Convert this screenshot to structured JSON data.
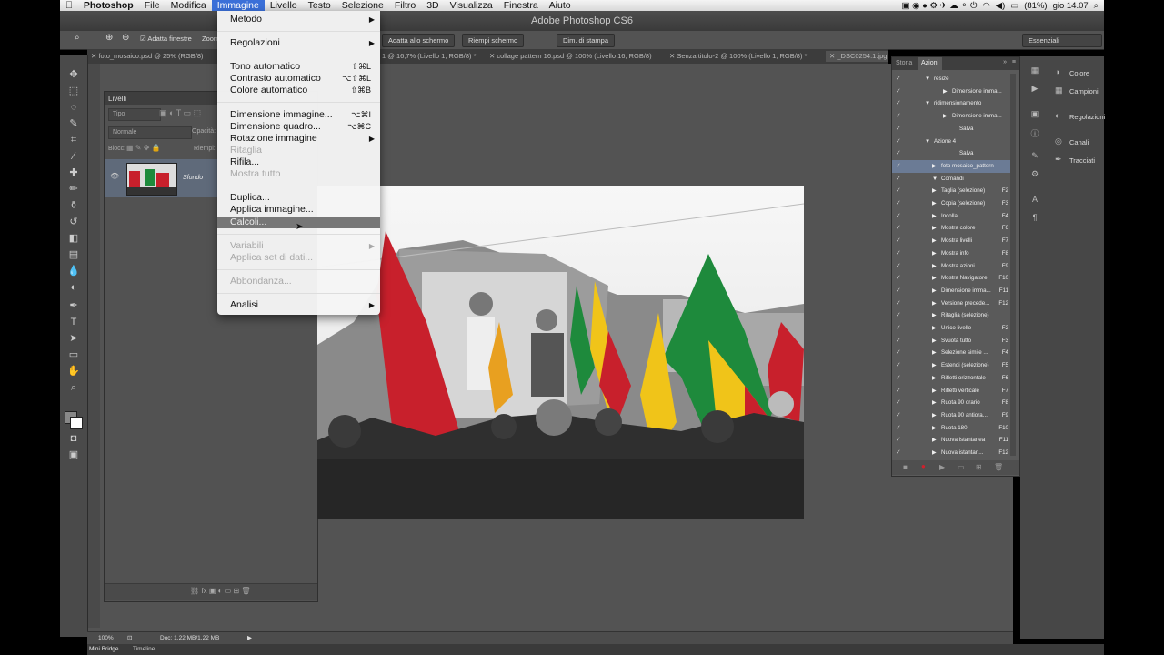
{
  "menubar": {
    "items": [
      "Photoshop",
      "File",
      "Modifica",
      "Immagine",
      "Livello",
      "Testo",
      "Selezione",
      "Filtro",
      "3D",
      "Visualizza",
      "Finestra",
      "Aiuto"
    ],
    "active": "Immagine",
    "battery": "(81%)",
    "clock": "gio 14.07"
  },
  "window": {
    "title": "Adobe Photoshop CS6"
  },
  "options": {
    "adatta_finestre": "Adatta finestre",
    "zoom": "Zoom",
    "btn_adatta": "Adatta allo schermo",
    "btn_riempi": "Riempi schermo",
    "btn_stampa": "Dim. di stampa",
    "workspace": "Essenziali"
  },
  "tabs": [
    "foto_mosaico.psd @ 25% (RGB/8)",
    "1 @ 16,7% (Livello 1, RGB/8) *",
    "collage pattern 16.psd @ 100% (Livello 16, RGB/8)",
    "Senza titolo-2 @ 100% (Livello 1, RGB/8) *",
    "_DSC0254.1.jpg @ 100% (RGB/8)"
  ],
  "layers": {
    "tab": "Livelli",
    "kind": "Tipo",
    "blend": "Normale",
    "opacity": "Opacità:",
    "lock": "Blocc:",
    "fill": "Riempi:",
    "layer_name": "Sfondo"
  },
  "menu": {
    "metodo": "Metodo",
    "regolazioni": "Regolazioni",
    "tono": "Tono automatico",
    "tono_sc": "⇧⌘L",
    "contrasto": "Contrasto automatico",
    "contrasto_sc": "⌥⇧⌘L",
    "colore": "Colore automatico",
    "colore_sc": "⇧⌘B",
    "dim_img": "Dimensione immagine...",
    "dim_img_sc": "⌥⌘I",
    "dim_quadro": "Dimensione quadro...",
    "dim_quadro_sc": "⌥⌘C",
    "rotazione": "Rotazione immagine",
    "ritaglia": "Ritaglia",
    "rifila": "Rifila...",
    "mostra": "Mostra tutto",
    "duplica": "Duplica...",
    "applica": "Applica immagine...",
    "calcoli": "Calcoli...",
    "variabili": "Variabili",
    "set_dati": "Applica set di dati...",
    "abbondanza": "Abbondanza...",
    "analisi": "Analisi"
  },
  "actions": {
    "tab_storia": "Storia",
    "tab_azioni": "Azioni",
    "rows": [
      {
        "label": "resize",
        "key": ""
      },
      {
        "label": "Dimensione imma...",
        "key": ""
      },
      {
        "label": "ridimensionamento",
        "key": ""
      },
      {
        "label": "Dimensione imma...",
        "key": ""
      },
      {
        "label": "Salva",
        "key": ""
      },
      {
        "label": "Azione 4",
        "key": ""
      },
      {
        "label": "Salva",
        "key": ""
      },
      {
        "label": "foto mosaico_pattern",
        "key": ""
      },
      {
        "label": "Comandi",
        "key": ""
      },
      {
        "label": "Taglia (selezione)",
        "key": "F2"
      },
      {
        "label": "Copia (selezione)",
        "key": "F3"
      },
      {
        "label": "Incolla",
        "key": "F4"
      },
      {
        "label": "Mostra colore",
        "key": "F6"
      },
      {
        "label": "Mostra livelli",
        "key": "F7"
      },
      {
        "label": "Mostra info",
        "key": "F8"
      },
      {
        "label": "Mostra azioni",
        "key": "F9"
      },
      {
        "label": "Mostra Navigatore",
        "key": "F10"
      },
      {
        "label": "Dimensione imma...",
        "key": "F11"
      },
      {
        "label": "Versione precede...",
        "key": "F12"
      },
      {
        "label": "Ritaglia (selezione)",
        "key": ""
      },
      {
        "label": "Unico livello",
        "key": "F2"
      },
      {
        "label": "Svuota tutto",
        "key": "F3"
      },
      {
        "label": "Selezione simile ...",
        "key": "F4"
      },
      {
        "label": "Estendi (selezione)",
        "key": "F5"
      },
      {
        "label": "Rifletti orizzontale",
        "key": "F6"
      },
      {
        "label": "Rifletti verticale",
        "key": "F7"
      },
      {
        "label": "Ruota 90 orario",
        "key": "F8"
      },
      {
        "label": "Ruota 90 antiora...",
        "key": "F9"
      },
      {
        "label": "Ruota 180",
        "key": "F10"
      },
      {
        "label": "Nuova istantanea",
        "key": "F11"
      },
      {
        "label": "Nuova istantan...",
        "key": "F12"
      }
    ]
  },
  "dock": {
    "colore": "Colore",
    "campioni": "Campioni",
    "regolazioni": "Regolazioni",
    "canali": "Canali",
    "tracciati": "Tracciati"
  },
  "status": {
    "zoom": "100%",
    "doc": "Doc: 1,22 MB/1,22 MB"
  },
  "bottom": {
    "bridge": "Mini Bridge",
    "timeline": "Timeline"
  },
  "colors": {
    "accent": "#3a6fd8",
    "panel": "#535353",
    "flag_red": "#c8202c",
    "flag_green": "#1e8a3c",
    "flag_yellow": "#f0c419"
  }
}
